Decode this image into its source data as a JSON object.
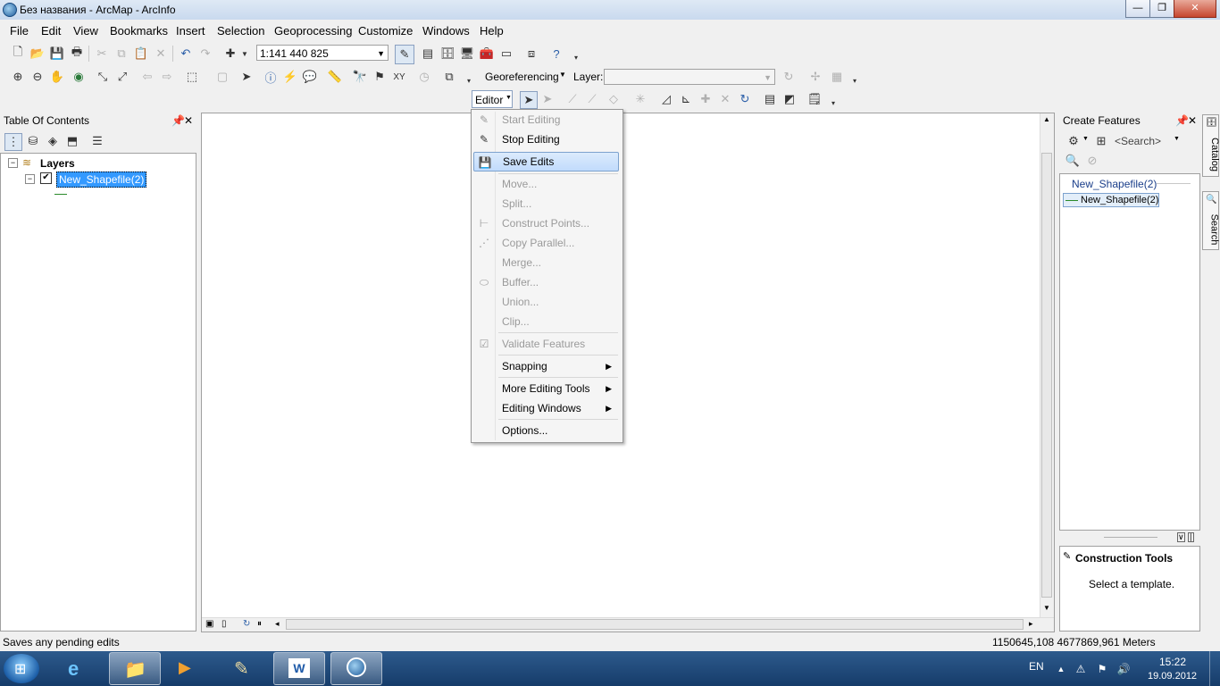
{
  "window": {
    "title": "Без названия - ArcMap - ArcInfo",
    "min": "—",
    "max": "❐",
    "close": "✕"
  },
  "menubar": [
    "File",
    "Edit",
    "View",
    "Bookmarks",
    "Insert",
    "Selection",
    "Geoprocessing",
    "Customize",
    "Windows",
    "Help"
  ],
  "toolbar": {
    "scale": "1:141 440 825",
    "georeferencing_label": "Georeferencing",
    "layer_label": "Layer:",
    "layer_value": "",
    "editor_label": "Editor"
  },
  "toc": {
    "title": "Table Of Contents",
    "layers_label": "Layers",
    "layer_name": "New_Shapefile(2)"
  },
  "editor_menu": [
    {
      "label": "Start Editing",
      "disabled": true
    },
    {
      "label": "Stop Editing",
      "disabled": false
    },
    {
      "label": "Save Edits",
      "disabled": false,
      "highlighted": true
    },
    {
      "label": "Move...",
      "disabled": true
    },
    {
      "label": "Split...",
      "disabled": true
    },
    {
      "label": "Construct Points...",
      "disabled": true
    },
    {
      "label": "Copy Parallel...",
      "disabled": true
    },
    {
      "label": "Merge...",
      "disabled": true
    },
    {
      "label": "Buffer...",
      "disabled": true
    },
    {
      "label": "Union...",
      "disabled": true
    },
    {
      "label": "Clip...",
      "disabled": true
    },
    {
      "label": "Validate Features",
      "disabled": true
    },
    {
      "label": "Snapping",
      "disabled": false,
      "submenu": true
    },
    {
      "label": "More Editing Tools",
      "disabled": false,
      "submenu": true
    },
    {
      "label": "Editing Windows",
      "disabled": false,
      "submenu": true
    },
    {
      "label": "Options...",
      "disabled": false
    }
  ],
  "create_features": {
    "title": "Create Features",
    "search_placeholder": "<Search>",
    "group_name": "New_Shapefile(2)",
    "template_name": "New_Shapefile(2)",
    "construction_title": "Construction Tools",
    "construction_hint": "Select a template."
  },
  "side_tabs": [
    "Catalog",
    "Search"
  ],
  "status": {
    "message": "Saves any pending edits",
    "coords": "1150645,108  4677869,961 Meters"
  },
  "taskbar": {
    "lang": "EN",
    "time": "15:22",
    "date": "19.09.2012"
  },
  "colors": {
    "selection": "#3399ff",
    "menu_highlight": "#c1dbfc",
    "taskbar": "#1e4a7c"
  }
}
